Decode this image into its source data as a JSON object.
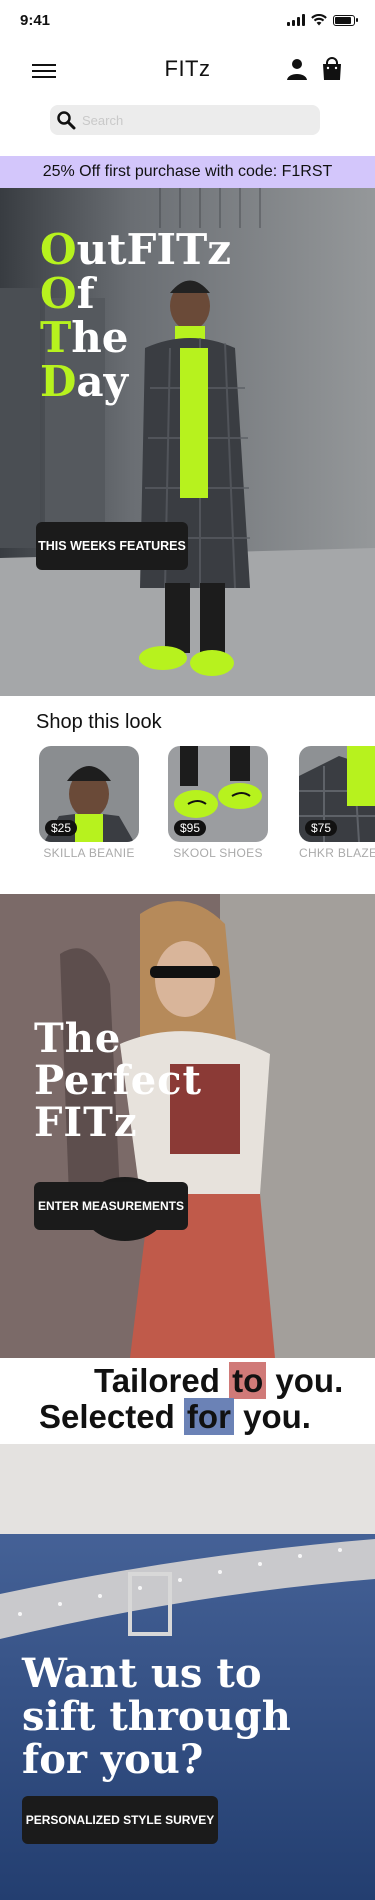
{
  "status_bar": {
    "time": "9:41"
  },
  "header": {
    "brand": "FITz"
  },
  "search": {
    "placeholder": "Search"
  },
  "promo": {
    "text": "25% Off first purchase with code: F1RST"
  },
  "hero1": {
    "lines": [
      {
        "initial": "O",
        "rest": "utFITz"
      },
      {
        "initial": "O",
        "rest": "f"
      },
      {
        "initial": "T",
        "rest": "he"
      },
      {
        "initial": "D",
        "rest": "ay"
      }
    ],
    "button_label": "THIS WEEKS FEATURES"
  },
  "shop_look": {
    "title": "Shop this look",
    "items": [
      {
        "price": "$25",
        "name": "SKILLA BEANIE"
      },
      {
        "price": "$95",
        "name": "SKOOL SHOES"
      },
      {
        "price": "$75",
        "name": "CHKR BLAZER"
      }
    ]
  },
  "hero2": {
    "lines": [
      "The",
      "Perfect",
      "FITz"
    ],
    "button_label": "ENTER MEASUREMENTS"
  },
  "tagline": {
    "line1": {
      "before": "Tailored",
      "mark": "to",
      "after": "you."
    },
    "line2": {
      "before": "Selected",
      "mark": "for",
      "after": "you."
    }
  },
  "hero3": {
    "lines": [
      "Want us to",
      "sift through",
      "for you?"
    ],
    "button_label": "PERSONALIZED STYLE SURVEY"
  },
  "colors": {
    "accent_green": "#b7f21e",
    "promo_bg": "#d3c6fb",
    "mark_red": "#d07a78",
    "mark_blue": "#6b82b6"
  },
  "icons": [
    "search-icon",
    "menu-icon",
    "account-icon",
    "shopping-bag-icon",
    "signal-icon",
    "wifi-icon",
    "battery-icon"
  ]
}
